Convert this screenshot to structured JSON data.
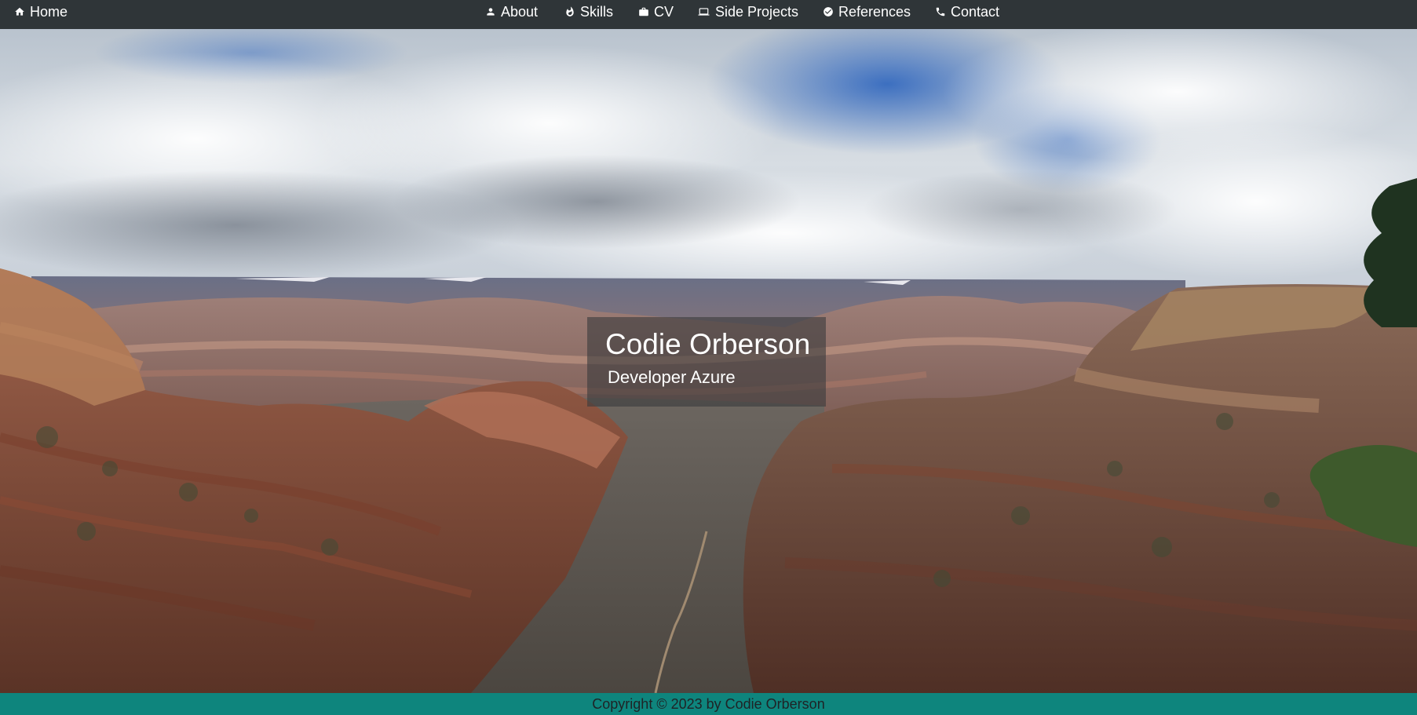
{
  "nav": {
    "home": {
      "label": "Home",
      "icon": "home-icon"
    },
    "items": [
      {
        "label": "About",
        "icon": "person-icon"
      },
      {
        "label": "Skills",
        "icon": "fire-icon"
      },
      {
        "label": "CV",
        "icon": "briefcase-icon"
      },
      {
        "label": "Side Projects",
        "icon": "laptop-icon"
      },
      {
        "label": "References",
        "icon": "check-circle-icon"
      },
      {
        "label": "Contact",
        "icon": "phone-icon"
      }
    ]
  },
  "hero": {
    "name": "Codie Orberson",
    "role": "Developer Azure",
    "background": "canyon-landscape-photo"
  },
  "footer": {
    "copyright": "Copyright © 2023 by Codie Orberson"
  },
  "colors": {
    "navbar": "#2f3538",
    "footer": "#0e857d",
    "name_box": "rgba(60,60,62,0.62)"
  }
}
